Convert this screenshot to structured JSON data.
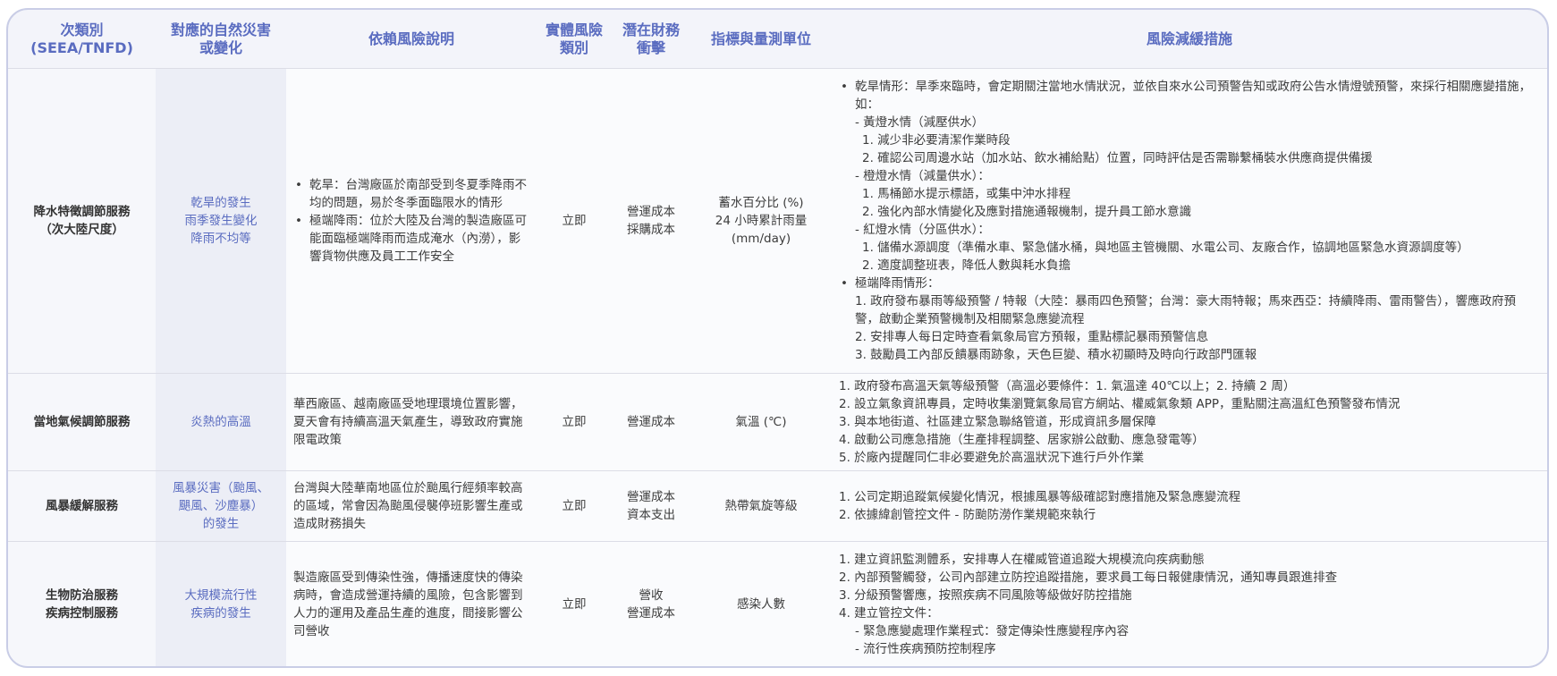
{
  "headers": [
    "次類別\n(SEEA/TNFD)",
    "對應的自然災害\n或變化",
    "依賴風險說明",
    "實體風險\n類別",
    "潛在財務\n衝擊",
    "指標與量測單位",
    "風險減緩措施"
  ],
  "rows": [
    {
      "subcat": "降水特徵調節服務\n（次大陸尺度）",
      "hazard": "乾旱的發生\n雨季發生變化\n降雨不均等",
      "desc": [
        "乾旱：台灣廠區於南部受到冬夏季降雨不均的問題，易於冬季面臨限水的情形",
        "極端降雨：位於大陸及台灣的製造廠區可能面臨極端降雨而造成淹水（內澇），影響貨物供應及員工工作安全"
      ],
      "risk_type": "立即",
      "finance": "營運成本\n採購成本",
      "metric": "蓄水百分比 (%)\n24 小時累計雨量\n(mm/day)",
      "measures": [
        {
          "lvl": "b",
          "text": "乾旱情形：旱季來臨時，會定期關注當地水情狀況，並依自來水公司預警告知或政府公告水情燈號預警，來採行相關應變措施，如："
        },
        {
          "lvl": "1",
          "text": "- 黃燈水情（減壓供水）"
        },
        {
          "lvl": "2",
          "text": "1. 減少非必要清潔作業時段"
        },
        {
          "lvl": "2",
          "text": "2. 確認公司周邊水站（加水站、飲水補給點）位置，同時評估是否需聯繫桶裝水供應商提供備援"
        },
        {
          "lvl": "1",
          "text": "- 橙燈水情（減量供水）："
        },
        {
          "lvl": "2",
          "text": "1. 馬桶節水提示標語，或集中沖水排程"
        },
        {
          "lvl": "2",
          "text": "2. 強化內部水情變化及應對措施通報機制，提升員工節水意識"
        },
        {
          "lvl": "1",
          "text": "- 紅燈水情（分區供水）："
        },
        {
          "lvl": "2",
          "text": "1. 儲備水源調度（準備水車、緊急儲水桶，與地區主管機關、水電公司、友廠合作，協調地區緊急水資源調度等）"
        },
        {
          "lvl": "2",
          "text": "2. 適度調整班表，降低人數與耗水負擔"
        },
        {
          "lvl": "b",
          "text": "極端降雨情形："
        },
        {
          "lvl": "1",
          "text": "1. 政府發布暴雨等級預警 / 特報（大陸：暴雨四色預警；台灣：豪大雨特報；馬來西亞：持續降雨、雷雨警告），響應政府預警，啟動企業預警機制及相關緊急應變流程"
        },
        {
          "lvl": "1",
          "text": "2. 安排專人每日定時查看氣象局官方預報，重點標記暴雨預警信息"
        },
        {
          "lvl": "1",
          "text": "3. 鼓勵員工內部反饋暴雨跡象，天色巨變、積水初顯時及時向行政部門匯報"
        }
      ]
    },
    {
      "subcat": "當地氣候調節服務",
      "hazard": "炎熱的高溫",
      "desc_text": "華西廠區、越南廠區受地理環境位置影響，夏天會有持續高溫天氣產生，導致政府實施限電政策",
      "risk_type": "立即",
      "finance": "營運成本",
      "metric": "氣溫 (℃)",
      "measures": [
        {
          "lvl": "0",
          "text": "1. 政府發布高溫天氣等級預警（高溫必要條件：1. 氣溫達 40℃以上；2. 持續 2 周）"
        },
        {
          "lvl": "0",
          "text": "2. 設立氣象資訊專員，定時收集瀏覽氣象局官方網站、權威氣象類 APP，重點關注高溫紅色預警發布情況"
        },
        {
          "lvl": "0",
          "text": "3. 與本地街道、社區建立緊急聯絡管道，形成資訊多層保障"
        },
        {
          "lvl": "0",
          "text": "4. 啟動公司應急措施（生產排程調整、居家辦公啟動、應急發電等）"
        },
        {
          "lvl": "0",
          "text": "5. 於廠內提醒同仁非必要避免於高溫狀況下進行戶外作業"
        }
      ]
    },
    {
      "subcat": "風暴緩解服務",
      "hazard": "風暴災害（颱風、\n颶風、沙塵暴）\n的發生",
      "desc_text": "台灣與大陸華南地區位於颱風行經頻率較高的區域，常會因為颱風侵襲停班影響生產或造成財務損失",
      "risk_type": "立即",
      "finance": "營運成本\n資本支出",
      "metric": "熱帶氣旋等級",
      "measures": [
        {
          "lvl": "0",
          "text": "1. 公司定期追蹤氣候變化情況，根據風暴等級確認對應措施及緊急應變流程"
        },
        {
          "lvl": "0",
          "text": "2. 依據緯創管控文件 - 防颱防澇作業規範來執行"
        }
      ]
    },
    {
      "subcat": "生物防治服務\n疾病控制服務",
      "hazard": "大規模流行性\n疾病的發生",
      "desc_text": "製造廠區受到傳染性強，傳播速度快的傳染病時，會造成營運持續的風險，包含影響到人力的運用及產品生產的進度，間接影響公司營收",
      "risk_type": "立即",
      "finance": "營收\n營運成本",
      "metric": "感染人數",
      "measures": [
        {
          "lvl": "0",
          "text": "1. 建立資訊監測體系，安排專人在權威管道追蹤大規模流向疾病動態"
        },
        {
          "lvl": "0",
          "text": "2. 內部預警觸發，公司內部建立防控追蹤措施，要求員工每日報健康情況，通知專員跟進排查"
        },
        {
          "lvl": "0",
          "text": "3. 分級預警響應，按照疾病不同風險等級做好防控措施"
        },
        {
          "lvl": "0",
          "text": "4. 建立管控文件："
        },
        {
          "lvl": "1",
          "text": "- 緊急應變處理作業程式：發定傳染性應變程序內容"
        },
        {
          "lvl": "1",
          "text": "- 流行性疾病預防控制程序"
        }
      ]
    }
  ]
}
